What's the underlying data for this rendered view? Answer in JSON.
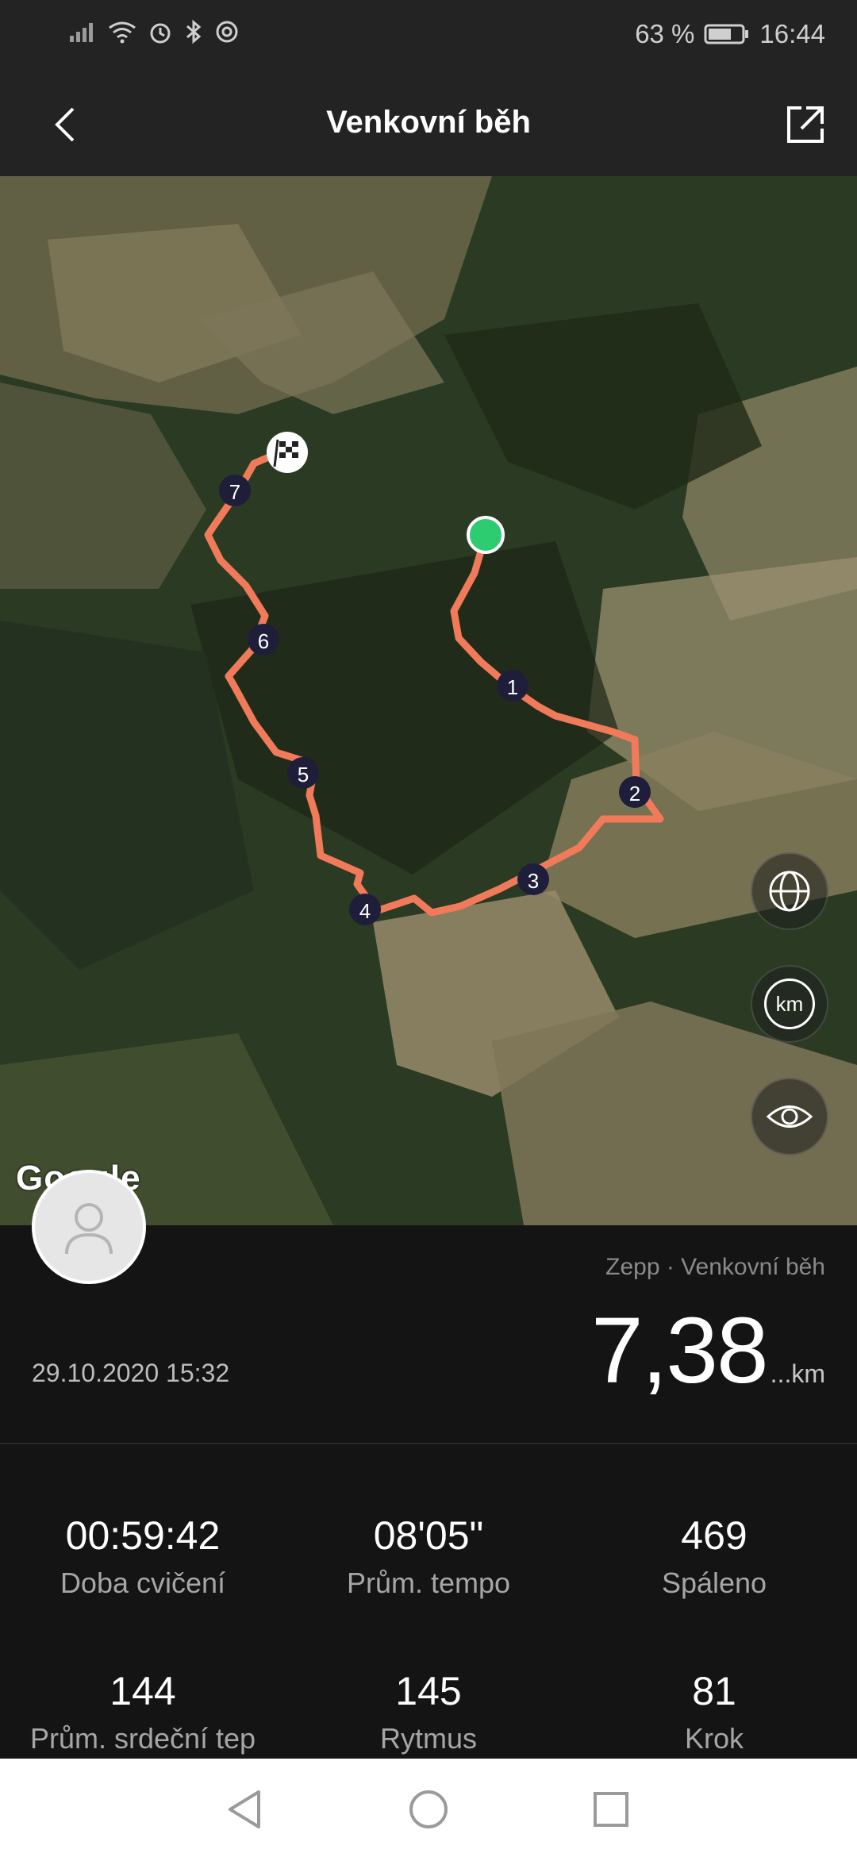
{
  "status_bar": {
    "battery": "63 %",
    "time": "16:44",
    "icons": [
      "signal-icon",
      "wifi-icon",
      "alarm-icon",
      "bluetooth-icon",
      "nfc-icon",
      "battery-icon"
    ]
  },
  "header": {
    "title": "Venkovní běh",
    "back_icon": "back-arrow-icon",
    "share_icon": "share-icon"
  },
  "map": {
    "attribution": "Google",
    "route_color": "#f07a5a",
    "start_color": "#2ecc71",
    "markers": [
      "1",
      "2",
      "3",
      "4",
      "5",
      "6",
      "7"
    ],
    "buttons": [
      {
        "name": "globe-icon"
      },
      {
        "name": "km-toggle",
        "label": "km"
      },
      {
        "name": "eye-icon"
      }
    ]
  },
  "summary": {
    "source": "Zepp · Venkovní běh",
    "distance": "7,38",
    "distance_unit": "...km",
    "date": "29.10.2020 15:32"
  },
  "stats": [
    {
      "value": "00:59:42",
      "label": "Doba cvičení"
    },
    {
      "value": "08'05\"",
      "label": "Prům. tempo"
    },
    {
      "value": "469",
      "label": "Spáleno"
    },
    {
      "value": "144",
      "label": "Prům. srdeční tep"
    },
    {
      "value": "145",
      "label": "Rytmus"
    },
    {
      "value": "81",
      "label": "Krok"
    }
  ],
  "nav": {
    "icons": [
      "nav-back-icon",
      "nav-home-icon",
      "nav-recents-icon"
    ]
  }
}
